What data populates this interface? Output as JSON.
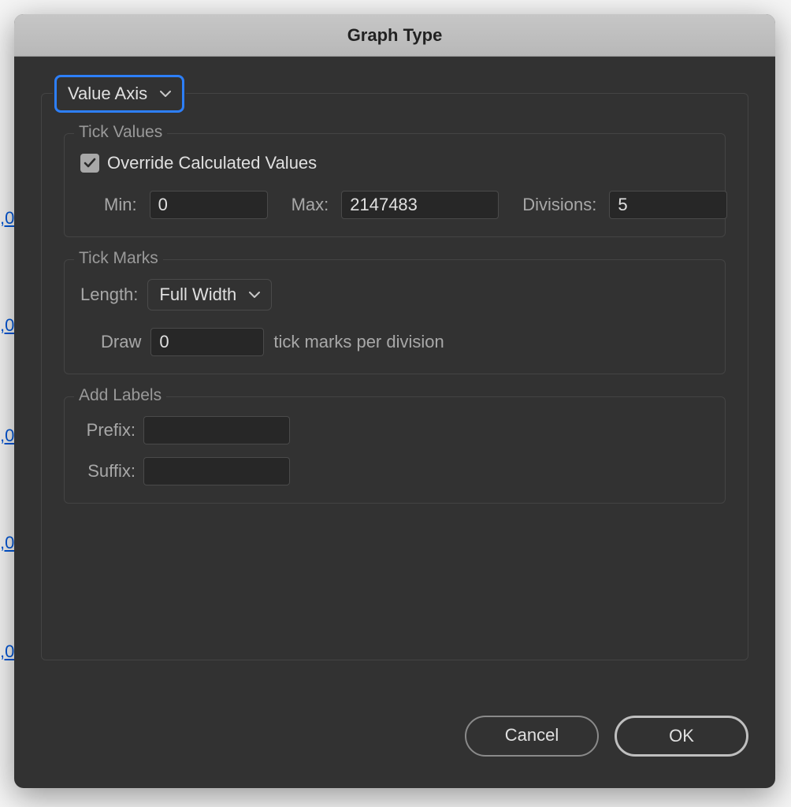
{
  "dialog": {
    "title": "Graph Type",
    "section_selected": "Value Axis"
  },
  "tick_values": {
    "legend": "Tick Values",
    "override_label": "Override Calculated Values",
    "override_checked": true,
    "min_label": "Min:",
    "min_value": "0",
    "max_label": "Max:",
    "max_value": "2147483",
    "divisions_label": "Divisions:",
    "divisions_value": "5"
  },
  "tick_marks": {
    "legend": "Tick Marks",
    "length_label": "Length:",
    "length_value": "Full Width",
    "draw_label": "Draw",
    "draw_value": "0",
    "draw_suffix": "tick marks per division"
  },
  "add_labels": {
    "legend": "Add Labels",
    "prefix_label": "Prefix:",
    "prefix_value": "",
    "suffix_label": "Suffix:",
    "suffix_value": ""
  },
  "buttons": {
    "cancel": "Cancel",
    "ok": "OK"
  },
  "background_marks": [
    ",0",
    ",0",
    ",0",
    ",0",
    ",0"
  ]
}
